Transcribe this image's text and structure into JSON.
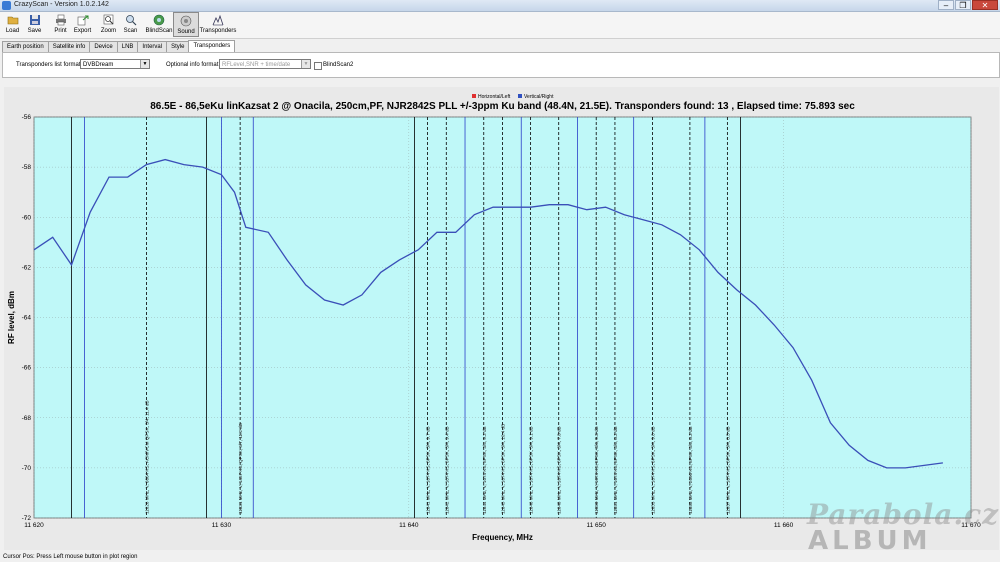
{
  "window": {
    "title": "CrazyScan - Version 1.0.2.142",
    "controls": [
      "–",
      "❐",
      "✕"
    ]
  },
  "toolbar": {
    "buttons": [
      {
        "label": "Load",
        "icon": "load-icon"
      },
      {
        "label": "Save",
        "icon": "save-icon"
      },
      {
        "label": "Print",
        "icon": "print-icon"
      },
      {
        "label": "Export",
        "icon": "export-icon"
      },
      {
        "label": "Zoom",
        "icon": "zoom-icon"
      },
      {
        "label": "Scan",
        "icon": "scan-icon"
      },
      {
        "label": "BlindScan",
        "icon": "blindscan-icon"
      },
      {
        "label": "Sound",
        "icon": "sound-icon",
        "pressed": true
      },
      {
        "label": "Transponders",
        "icon": "transponders-icon"
      }
    ]
  },
  "tabs": [
    "Earth position",
    "Satellite info",
    "Device",
    "LNB",
    "Interval",
    "Style",
    "Transponders"
  ],
  "active_tab": "Transponders",
  "panel": {
    "list_format_label": "Transponders list format",
    "list_format_value": "DVBDream",
    "optional_label": "Optional info format",
    "optional_value": "RFLevel,SNR + time/date",
    "blindscan2_label": "BlindScan2"
  },
  "status": {
    "text": "Cursor Pos: Press Left mouse button in plot region"
  },
  "watermark": {
    "line1": "Parabola.cz",
    "line2": "ALBUM"
  },
  "chart_data": {
    "type": "line",
    "title": "86.5E - 86,5eKu linKazsat 2 @ Onacila, 250cm,PF, NJR2842S PLL +/-3ppm Ku band (48.4N, 21.5E). Transponders found: 13 , Elapsed time: 75.893 sec",
    "xlabel": "Frequency, MHz",
    "ylabel": "RF level, dBm",
    "xlim": [
      11620,
      11670
    ],
    "ylim": [
      -72,
      -56
    ],
    "x_ticks": [
      11620,
      11630,
      11640,
      11650,
      11660,
      11670
    ],
    "x_tick_labels": [
      "11 620",
      "11 630",
      "11 640",
      "11 650",
      "11 660",
      "11 670"
    ],
    "y_ticks": [
      -56,
      -58,
      -60,
      -62,
      -64,
      -66,
      -68,
      -70,
      -72
    ],
    "legend": {
      "placement": "top-center",
      "entries": [
        {
          "name": "Horizontal/Left",
          "color": "#e03030"
        },
        {
          "name": "Vertical/Right",
          "color": "#3050c0"
        }
      ]
    },
    "colors": {
      "plot_bg": "#bff8f8",
      "series": "#3a4fb8",
      "grid": "#8fa0a0",
      "marker_dark": "#000000",
      "marker_blue": "#2a3ec8"
    },
    "series": [
      {
        "name": "Vertical/Right",
        "x": [
          11620,
          11621,
          11622,
          11623,
          11624,
          11625,
          11626,
          11627,
          11628,
          11629,
          11630,
          11630.7,
          11631.3,
          11632.5,
          11633.5,
          11634.5,
          11635.5,
          11636.5,
          11637.5,
          11638.5,
          11639.5,
          11640.5,
          11641.5,
          11642.5,
          11643.5,
          11644.5,
          11645.5,
          11646.5,
          11647.5,
          11648.5,
          11649.5,
          11650.5,
          11651.5,
          11652.5,
          11653.5,
          11654.5,
          11655.5,
          11656.5,
          11657.5,
          11658.5,
          11659.5,
          11660.5,
          11661.5,
          11662.5,
          11663.5,
          11664.5,
          11665.5,
          11666.5,
          11667.5,
          11668.5
        ],
        "y": [
          -61.3,
          -60.8,
          -61.9,
          -59.8,
          -58.4,
          -58.4,
          -57.9,
          -57.7,
          -57.9,
          -58.0,
          -58.3,
          -59.0,
          -60.4,
          -60.6,
          -61.7,
          -62.7,
          -63.3,
          -63.5,
          -63.1,
          -62.2,
          -61.7,
          -61.3,
          -60.6,
          -60.6,
          -59.9,
          -59.6,
          -59.6,
          -59.6,
          -59.5,
          -59.5,
          -59.7,
          -59.6,
          -59.9,
          -60.1,
          -60.3,
          -60.7,
          -61.3,
          -62.2,
          -62.9,
          -63.5,
          -64.3,
          -65.2,
          -66.5,
          -68.2,
          -69.1,
          -69.7,
          -70.0,
          -70.0,
          -69.9,
          -69.8
        ]
      }
    ],
    "markers": [
      {
        "freq": 11622.0,
        "style": "solid",
        "color": "dark",
        "label": ""
      },
      {
        "freq": 11622.7,
        "style": "solid",
        "color": "blue",
        "label": ""
      },
      {
        "freq": 11626.0,
        "style": "dashed",
        "color": "dark",
        "label": "11626 MHz, V, 6664 KS, ACM/VCM QPSK, 3/4, 11.4 dB"
      },
      {
        "freq": 11629.2,
        "style": "solid",
        "color": "dark",
        "label": ""
      },
      {
        "freq": 11630.0,
        "style": "solid",
        "color": "blue",
        "label": ""
      },
      {
        "freq": 11631.0,
        "style": "dashed",
        "color": "dark",
        "label": "11631 MHz, V, 1457 KS, QPSK, 6/7, 11.2 dB"
      },
      {
        "freq": 11631.7,
        "style": "solid",
        "color": "blue",
        "label": ""
      },
      {
        "freq": 11640.3,
        "style": "solid",
        "color": "dark",
        "label": ""
      },
      {
        "freq": 11641.0,
        "style": "dashed",
        "color": "dark",
        "label": "11641 MHz, V, 1074 KS, 8PSK, 3/4, 9.7 dB"
      },
      {
        "freq": 11642.0,
        "style": "dashed",
        "color": "dark",
        "label": "11642 MHz, V, 1074 KS, 8PSK, 3/4, 9.4 dB"
      },
      {
        "freq": 11643.0,
        "style": "solid",
        "color": "blue",
        "label": ""
      },
      {
        "freq": 11644.0,
        "style": "dashed",
        "color": "dark",
        "label": "11644 MHz, V, 1074 KS, 8PSK, 3/4, 9.2 dB"
      },
      {
        "freq": 11645.0,
        "style": "dashed",
        "color": "dark",
        "label": "11645 MHz, V, 1074 KS, 8PSK, 3/4, 10.4 dB"
      },
      {
        "freq": 11646.0,
        "style": "solid",
        "color": "blue",
        "label": ""
      },
      {
        "freq": 11646.5,
        "style": "dashed",
        "color": "dark",
        "label": "11646 MHz, V, 1074 KS, 8PSK, 3/4, 9.1 dB"
      },
      {
        "freq": 11648.0,
        "style": "dashed",
        "color": "dark",
        "label": "11648 MHz, V, 1074 KS, 8PSK, 3/4, 7.8 dB"
      },
      {
        "freq": 11649.0,
        "style": "solid",
        "color": "blue",
        "label": ""
      },
      {
        "freq": 11650.0,
        "style": "dashed",
        "color": "dark",
        "label": "11650 MHz, V, 1074 KS, 8PSK, 3/4, 9.3 dB"
      },
      {
        "freq": 11651.0,
        "style": "dashed",
        "color": "dark",
        "label": "11651 MHz, V, 1074 KS, 8PSK, 3/4, 8.2 dB"
      },
      {
        "freq": 11652.0,
        "style": "solid",
        "color": "blue",
        "label": ""
      },
      {
        "freq": 11653.0,
        "style": "dashed",
        "color": "dark",
        "label": "11653 MHz, V, 1074 KS, 8PSK, 3/4, 9.0 dB"
      },
      {
        "freq": 11655.0,
        "style": "dashed",
        "color": "dark",
        "label": "11655 MHz, V, 2090 KS, 8PSK, 3/4, 8.2 dB"
      },
      {
        "freq": 11655.8,
        "style": "solid",
        "color": "blue",
        "label": ""
      },
      {
        "freq": 11657.0,
        "style": "dashed",
        "color": "dark",
        "label": "11657 MHz, V, 1074 KS, 8PSK, 3/4, 8.5 dB"
      },
      {
        "freq": 11657.7,
        "style": "solid",
        "color": "dark",
        "label": ""
      }
    ]
  }
}
